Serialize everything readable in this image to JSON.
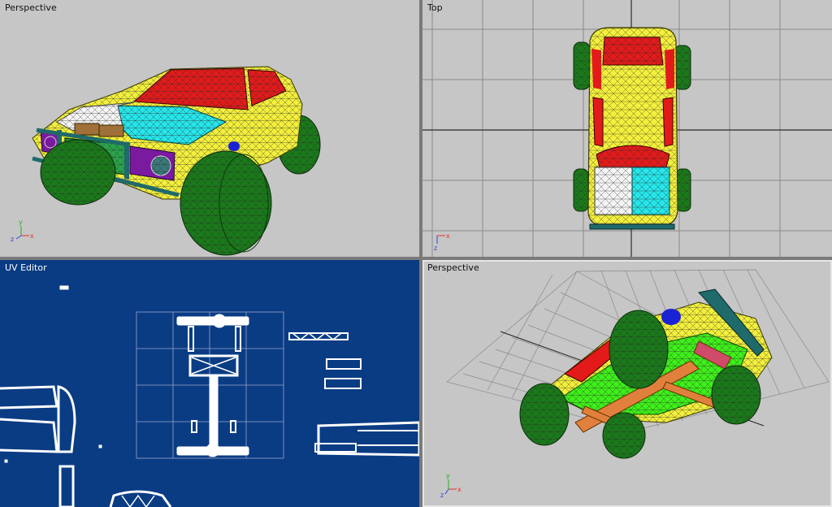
{
  "viewports": {
    "top_left": {
      "label": "Perspective"
    },
    "top_right": {
      "label": "Top"
    },
    "bottom_left": {
      "label": "UV Editor"
    },
    "bottom_right": {
      "label": "Perspective"
    }
  },
  "axes": {
    "x": "x",
    "y": "y",
    "z": "z"
  },
  "colors": {
    "viewport_bg": "#c6c6c6",
    "uv_bg": "#0a3c84",
    "body_yellow": "#f3ef3c",
    "roof_red": "#e31a1a",
    "windshield_cyan": "#26e6ea",
    "hood_white": "#f4f4f4",
    "tire_green": "#1a7a1a",
    "grille_green": "#2aa44a",
    "chassis_orange": "#e0803c",
    "underbody_lime": "#3ef01a",
    "bumper_teal": "#1f6a6a",
    "light_purple": "#7a1aa0",
    "accent_blue": "#1a22d6"
  }
}
